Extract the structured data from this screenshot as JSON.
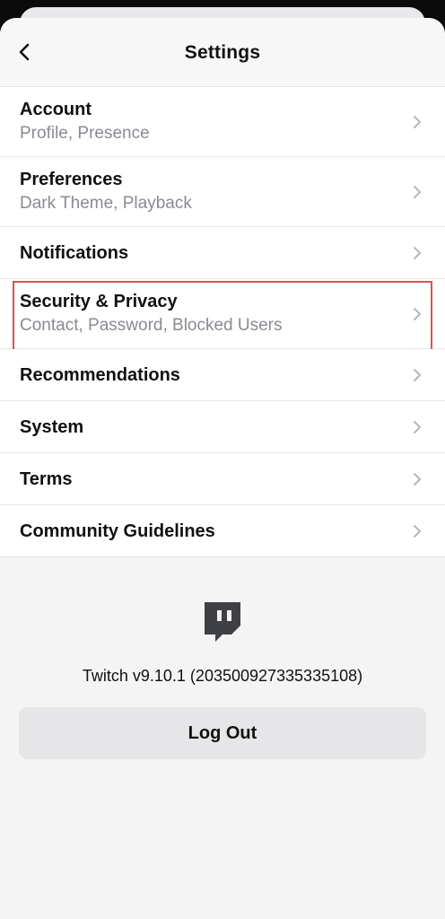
{
  "header": {
    "title": "Settings"
  },
  "items": [
    {
      "title": "Account",
      "subtitle": "Profile, Presence"
    },
    {
      "title": "Preferences",
      "subtitle": "Dark Theme, Playback"
    },
    {
      "title": "Notifications"
    },
    {
      "title": "Security & Privacy",
      "subtitle": "Contact, Password, Blocked Users",
      "highlighted": true
    },
    {
      "title": "Recommendations"
    },
    {
      "title": "System"
    },
    {
      "title": "Terms"
    },
    {
      "title": "Community Guidelines"
    }
  ],
  "footer": {
    "version_text": "Twitch v9.10.1 (203500927335335108)",
    "logout_label": "Log Out"
  },
  "icons": {
    "back": "chevron-left-icon",
    "row_chevron": "chevron-right-icon",
    "logo": "twitch-logo"
  },
  "colors": {
    "highlight": "#d9534f",
    "logo": "#3f3f46"
  }
}
